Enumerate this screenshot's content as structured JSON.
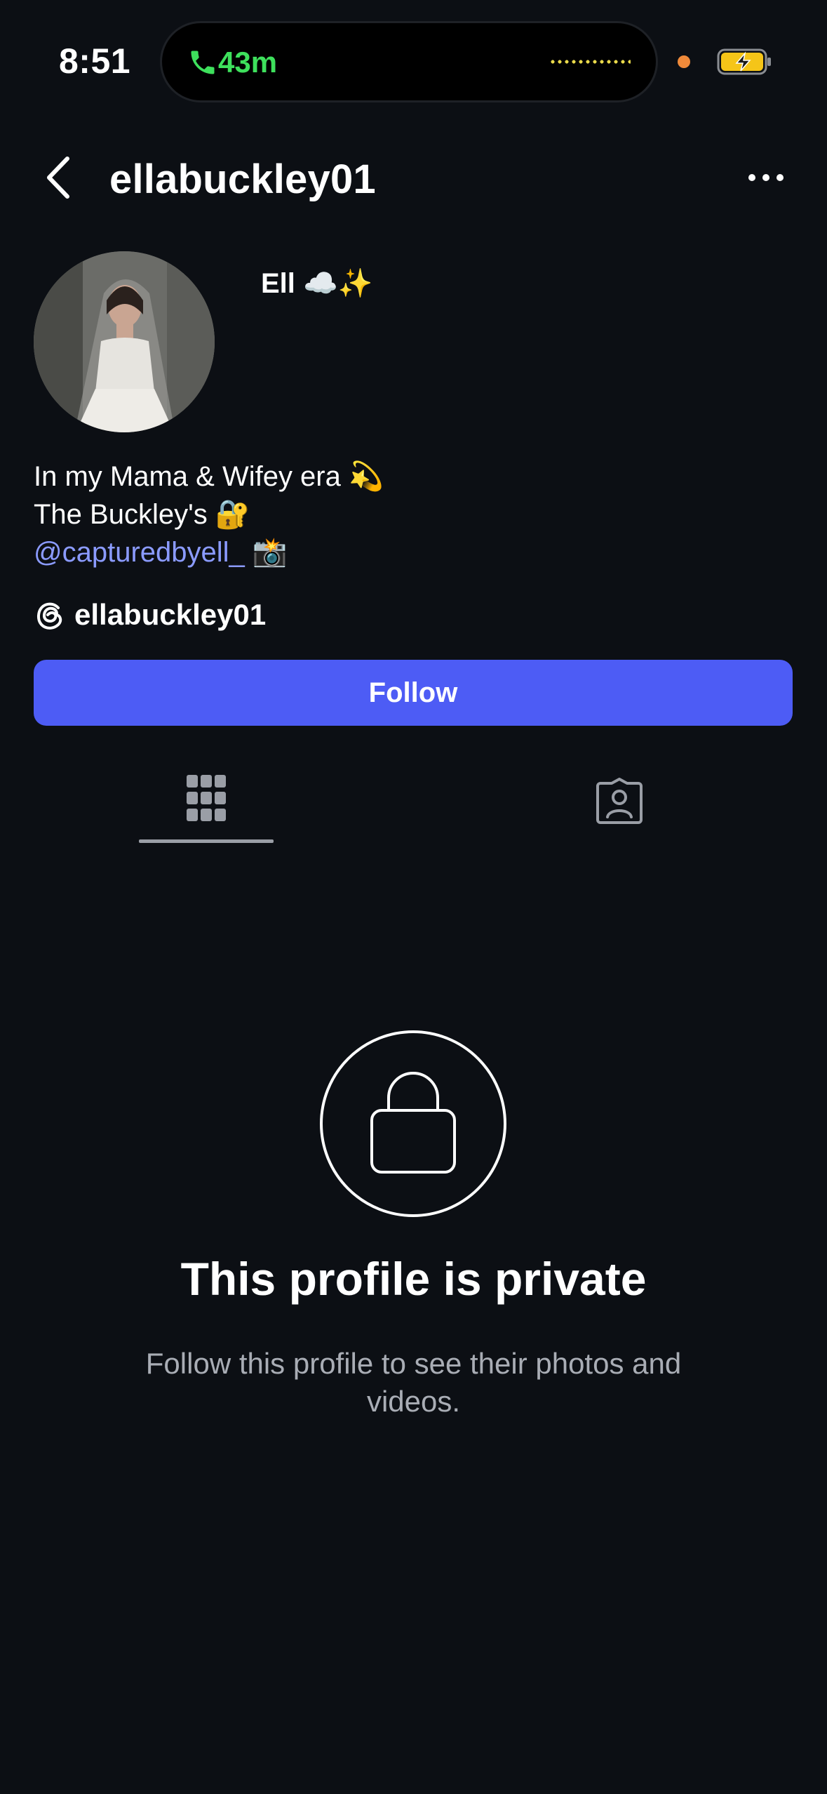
{
  "status_bar": {
    "time": "8:51",
    "call_duration": "43m"
  },
  "header": {
    "username": "ellabuckley01"
  },
  "profile": {
    "display_name": "Ell ☁️✨",
    "bio": {
      "line1": "In my Mama & Wifey era 💫",
      "line2": "The Buckley's 🔐",
      "line3_mention": "@capturedbyell_",
      "line3_suffix": " 📸"
    },
    "threads_username": "ellabuckley01"
  },
  "actions": {
    "follow_label": "Follow"
  },
  "tabs": [
    {
      "icon": "grid-icon",
      "active": true
    },
    {
      "icon": "tagged-icon",
      "active": false
    }
  ],
  "private_notice": {
    "title": "This profile is private",
    "description": "Follow this profile to see their photos and videos."
  },
  "colors": {
    "background": "#0c0f14",
    "follow_button": "#4d5cf5",
    "mention": "#8b9bff",
    "call_green": "#3ee05c"
  }
}
